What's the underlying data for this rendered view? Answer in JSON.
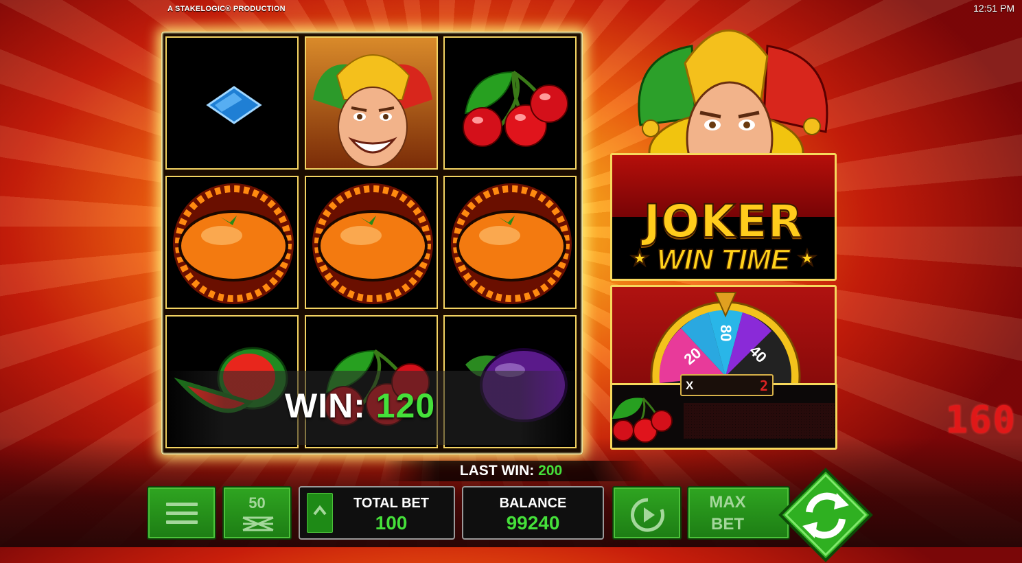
{
  "header": {
    "producer": "A STAKELOGIC® PRODUCTION",
    "clock": "12:51 PM"
  },
  "reels": [
    [
      "blue-diamond",
      "joker",
      "cherries"
    ],
    [
      "burning-orange",
      "burning-orange",
      "burning-orange"
    ],
    [
      "watermelon",
      "cherries",
      "plum"
    ]
  ],
  "win_banner": {
    "label": "WIN:",
    "value": "120"
  },
  "logo": {
    "title": "JOKER",
    "subtitle": "WIN TIME",
    "star": "★"
  },
  "wheel": {
    "segments": [
      "20",
      "80",
      "40"
    ],
    "multiplier_label": "X",
    "multiplier_value": "2",
    "payout_value": "160",
    "payout_symbol": "cherries"
  },
  "footer": {
    "last_win_label": "LAST WIN:",
    "last_win_value": "200",
    "lines_value": "50",
    "total_bet_label": "TOTAL BET",
    "total_bet_value": "100",
    "balance_label": "BALANCE",
    "balance_value": "99240",
    "max_bet_line1": "MAX",
    "max_bet_line2": "BET"
  },
  "colors": {
    "accent_green": "#45e03a",
    "button_green": "#2fa521",
    "frame_gold": "#f4d463",
    "led_red": "#e01818"
  }
}
